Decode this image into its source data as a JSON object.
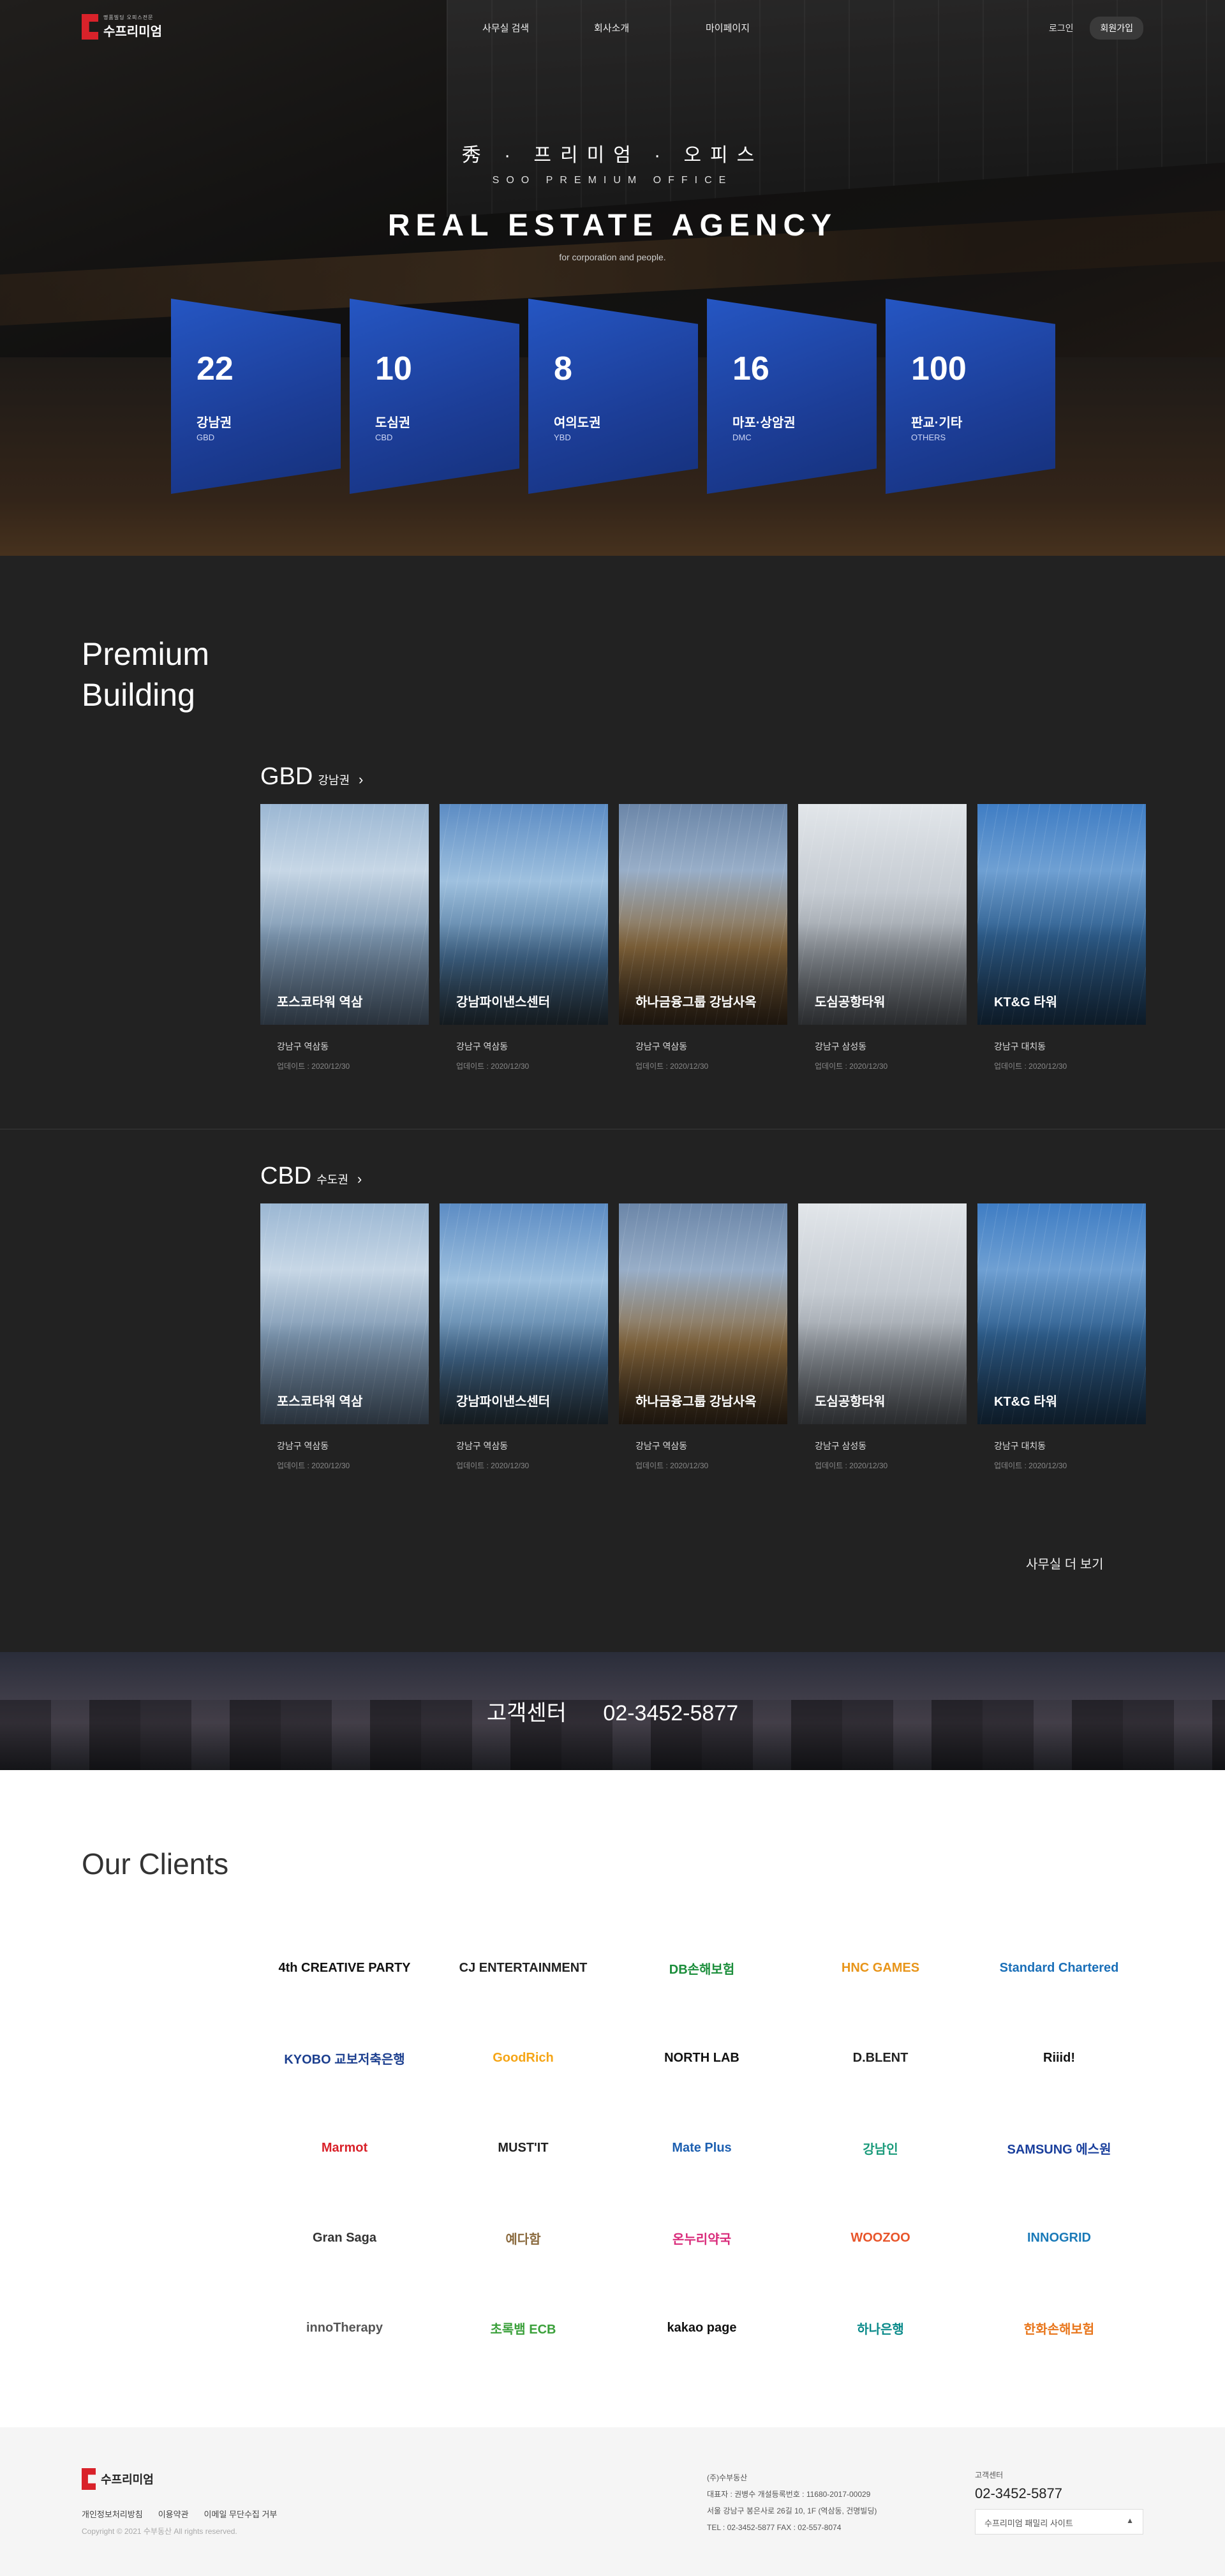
{
  "gnb": {
    "logo_sub": "명품빌딩 오피스전문",
    "logo_name": "수프리미엄",
    "menu": [
      "사무실 검색",
      "회사소개",
      "마이페이지"
    ],
    "login": "로그인",
    "join": "회원가입"
  },
  "hero": {
    "kr": "秀 · 프리미엄 · 오피스",
    "en": "SOO PREMIUM OFFICE",
    "title": "REAL ESTATE AGENCY",
    "tagline": "for corporation and people.",
    "cards": [
      {
        "num": "22",
        "area": "강남권",
        "code": "GBD"
      },
      {
        "num": "10",
        "area": "도심권",
        "code": "CBD"
      },
      {
        "num": "8",
        "area": "여의도권",
        "code": "YBD"
      },
      {
        "num": "16",
        "area": "마포·상암권",
        "code": "DMC"
      },
      {
        "num": "100",
        "area": "판교·기타",
        "code": "OTHERS"
      }
    ]
  },
  "premium": {
    "title_line1": "Premium",
    "title_line2": "Building",
    "sections": [
      {
        "big": "GBD",
        "small": "강남권",
        "items": [
          {
            "name": "포스코타워 역삼",
            "loc": "강남구 역삼동",
            "upd": "업데이트 : 2020/12/30"
          },
          {
            "name": "강남파이낸스센터",
            "loc": "강남구 역삼동",
            "upd": "업데이트 : 2020/12/30"
          },
          {
            "name": "하나금융그룹 강남사옥",
            "loc": "강남구 역삼동",
            "upd": "업데이트 : 2020/12/30"
          },
          {
            "name": "도심공항타워",
            "loc": "강남구 삼성동",
            "upd": "업데이트 : 2020/12/30"
          },
          {
            "name": "KT&G 타워",
            "loc": "강남구 대치동",
            "upd": "업데이트 : 2020/12/30"
          }
        ]
      },
      {
        "big": "CBD",
        "small": "수도권",
        "items": [
          {
            "name": "포스코타워 역삼",
            "loc": "강남구 역삼동",
            "upd": "업데이트 : 2020/12/30"
          },
          {
            "name": "강남파이낸스센터",
            "loc": "강남구 역삼동",
            "upd": "업데이트 : 2020/12/30"
          },
          {
            "name": "하나금융그룹 강남사옥",
            "loc": "강남구 역삼동",
            "upd": "업데이트 : 2020/12/30"
          },
          {
            "name": "도심공항타워",
            "loc": "강남구 삼성동",
            "upd": "업데이트 : 2020/12/30"
          },
          {
            "name": "KT&G 타워",
            "loc": "강남구 대치동",
            "upd": "업데이트 : 2020/12/30"
          }
        ]
      }
    ],
    "more": "사무실 더 보기"
  },
  "cs": {
    "label": "고객센터",
    "tel": "02-3452-5877"
  },
  "clients": {
    "title": "Our Clients",
    "logos": [
      {
        "t": "4th CREATIVE PARTY",
        "c": "#111"
      },
      {
        "t": "CJ ENTERTAINMENT",
        "c": "#222"
      },
      {
        "t": "DB손해보험",
        "c": "#1a8d3a"
      },
      {
        "t": "HNC GAMES",
        "c": "#e8951a"
      },
      {
        "t": "Standard Chartered",
        "c": "#1a6fb8"
      },
      {
        "t": "KYOBO 교보저축은행",
        "c": "#1c3f8f"
      },
      {
        "t": "GoodRich",
        "c": "#f5a516"
      },
      {
        "t": "NORTH LAB",
        "c": "#111"
      },
      {
        "t": "D.BLENT",
        "c": "#222"
      },
      {
        "t": "Riiid!",
        "c": "#111"
      },
      {
        "t": "Marmot",
        "c": "#d9222a"
      },
      {
        "t": "MUST'IT",
        "c": "#222"
      },
      {
        "t": "Mate Plus",
        "c": "#1c5fb0"
      },
      {
        "t": "강남인",
        "c": "#1a9a7a"
      },
      {
        "t": "SAMSUNG 에스원",
        "c": "#1a3f9c"
      },
      {
        "t": "Gran Saga",
        "c": "#333"
      },
      {
        "t": "예다함",
        "c": "#8a6a3e"
      },
      {
        "t": "온누리약국",
        "c": "#d92a7a"
      },
      {
        "t": "WOOZOO",
        "c": "#e8552a"
      },
      {
        "t": "INNOGRID",
        "c": "#1a7ab8"
      },
      {
        "t": "innoTherapy",
        "c": "#555"
      },
      {
        "t": "초록뱀 ECB",
        "c": "#3aa03a"
      },
      {
        "t": "kakao page",
        "c": "#111"
      },
      {
        "t": "하나은행",
        "c": "#0a8a8a"
      },
      {
        "t": "한화손해보험",
        "c": "#e8751a"
      }
    ]
  },
  "footer": {
    "logo_name": "수프리미엄",
    "links": [
      "개인정보처리방침",
      "이용약관",
      "이메일 무단수집 거부"
    ],
    "copyright": "Copyright © 2021 수부동산 All rights reserved.",
    "company": "(주)수부동산",
    "info1": "대표자 : 권병수    개설등록번호 : 11680-2017-00029",
    "info2": "서울 강남구 봉은사로 26길 10, 1F (역삼동, 건명빌딩)",
    "info3": "TEL : 02-3452-5877     FAX : 02-557-8074",
    "cs_label": "고객센터",
    "cs_tel": "02-3452-5877",
    "family": "수프리미엄 패밀리 사이트",
    "family_arrow": "▲"
  },
  "colors": {
    "brand": "#d9222a",
    "card_blue": "#1f47a8",
    "dark_bg": "#222222"
  }
}
